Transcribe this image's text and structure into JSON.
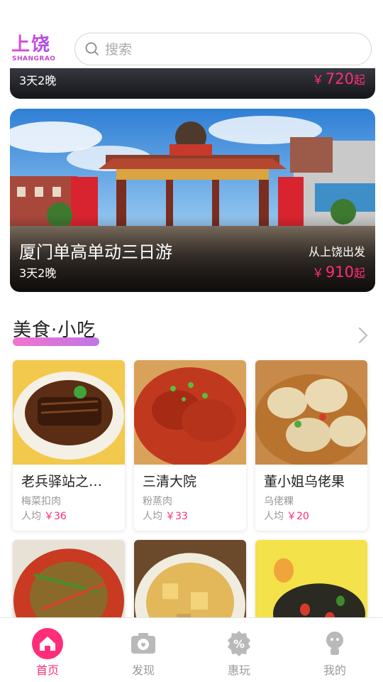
{
  "header": {
    "logo_cn": "上饶",
    "logo_en": "SHANGRAO",
    "search_placeholder": "搜索"
  },
  "tours": [
    {
      "duration": "3天2晚",
      "price_symbol": "￥",
      "price": "720",
      "price_suffix": "起"
    },
    {
      "title": "厦门单高单动三日游",
      "duration": "3天2晚",
      "departure": "从上饶出发",
      "price_symbol": "￥",
      "price": "910",
      "price_suffix": "起"
    }
  ],
  "food_section": {
    "title": "美食·小吃",
    "items": [
      {
        "name": "老兵驿站之…",
        "dish": "梅菜扣肉",
        "avg_label": "人均",
        "price": "￥36"
      },
      {
        "name": "三清大院",
        "dish": "粉蒸肉",
        "avg_label": "人均",
        "price": "￥33"
      },
      {
        "name": "董小姐乌佬果",
        "dish": "乌佬粿",
        "avg_label": "人均",
        "price": "￥20"
      }
    ]
  },
  "bottom_nav": [
    {
      "label": "首页",
      "icon": "home-icon",
      "active": true
    },
    {
      "label": "发现",
      "icon": "camera-icon",
      "active": false
    },
    {
      "label": "惠玩",
      "icon": "discount-icon",
      "active": false
    },
    {
      "label": "我的",
      "icon": "profile-icon",
      "active": false
    }
  ],
  "colors": {
    "accent": "#ff2d7a",
    "brand_gradient_start": "#e64ad0",
    "brand_gradient_end": "#a64de8",
    "nav_inactive": "#999999"
  }
}
